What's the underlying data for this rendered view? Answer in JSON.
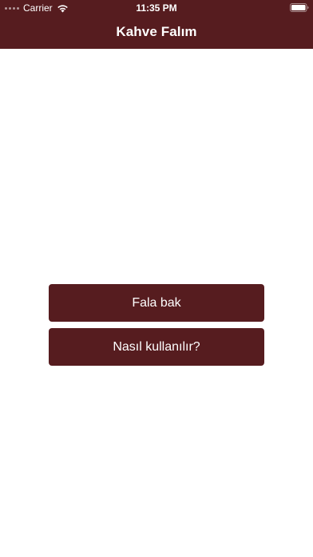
{
  "status_bar": {
    "carrier": "Carrier",
    "time": "11:35 PM",
    "signal_icon": "signal-dots-icon",
    "wifi_icon": "wifi-icon",
    "battery_icon": "battery-icon",
    "battery_level": 1.0
  },
  "nav": {
    "title": "Kahve Falım"
  },
  "buttons": {
    "fala_bak": "Fala bak",
    "nasil_kullanilir": "Nasıl kullanılır?"
  },
  "colors": {
    "accent": "#561c1f",
    "background": "#ffffff",
    "text_on_accent": "#ffffff"
  }
}
